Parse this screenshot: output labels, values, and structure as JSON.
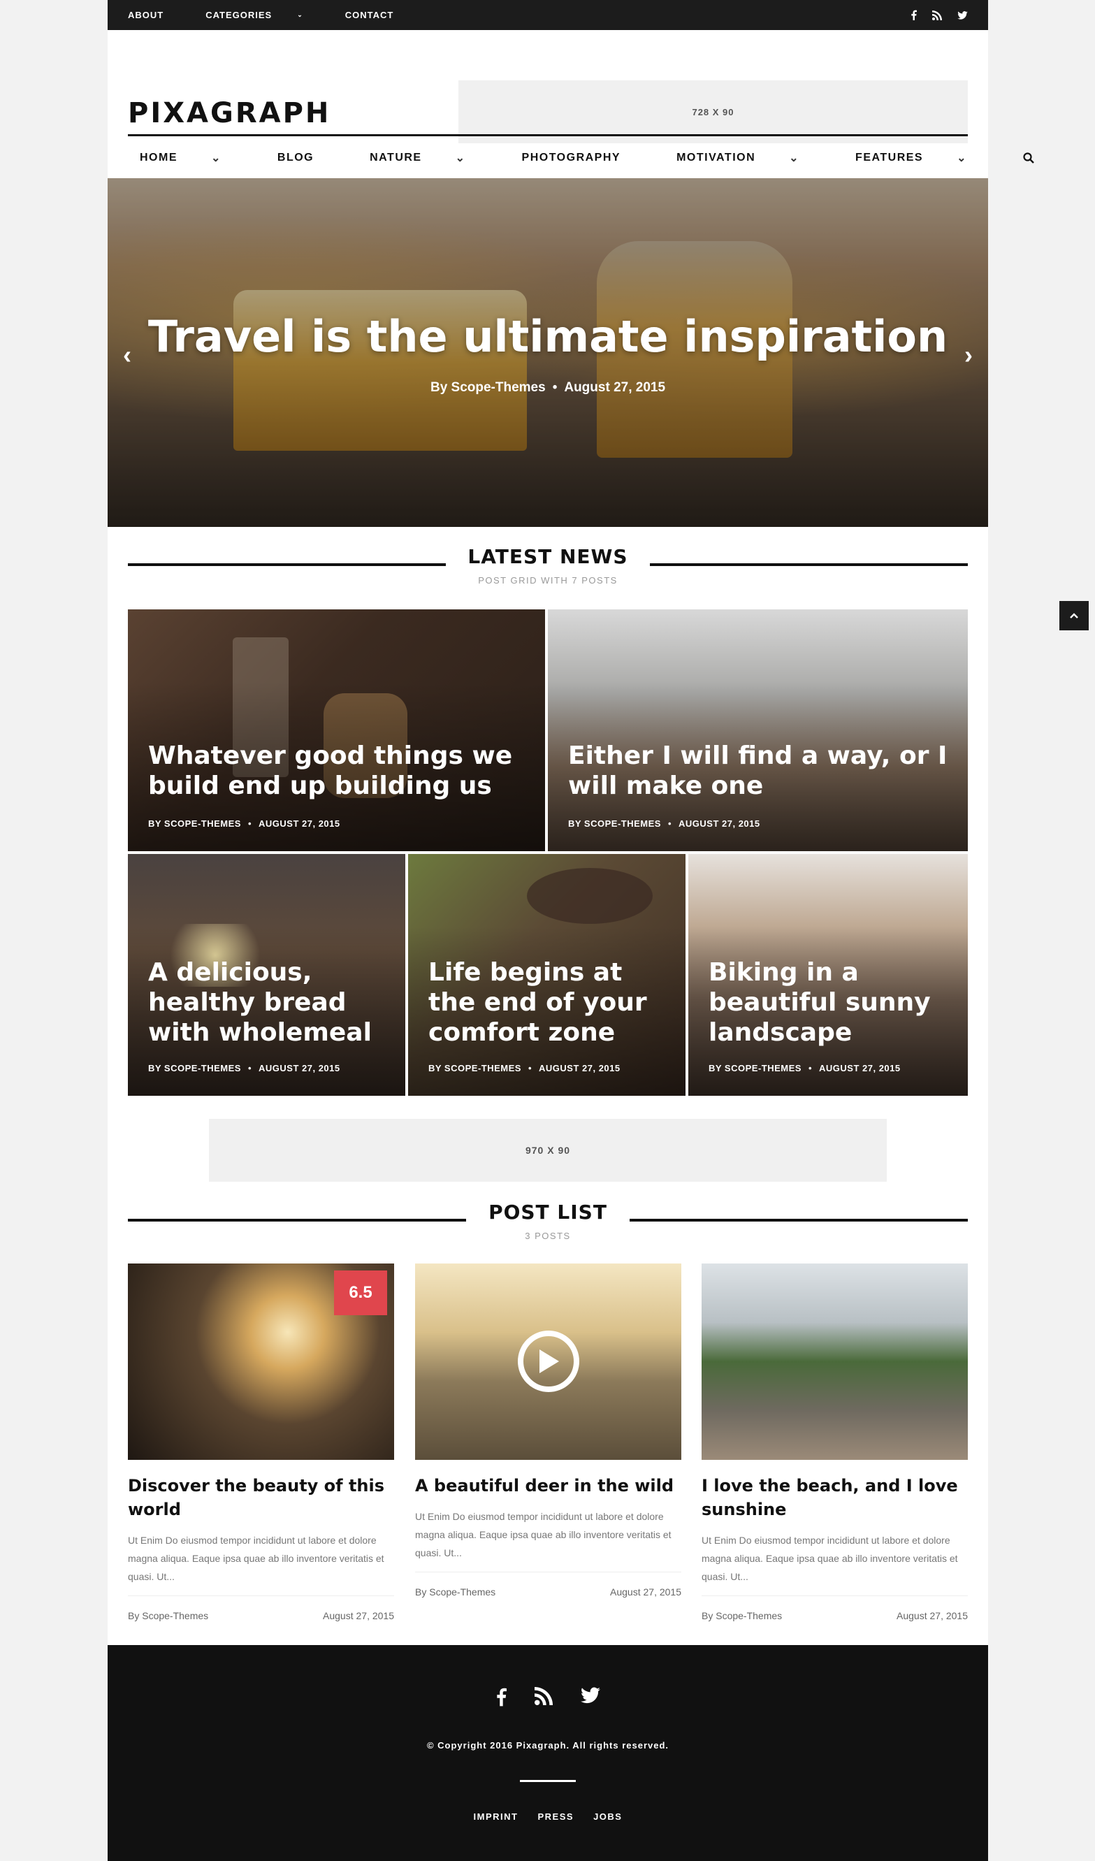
{
  "topbar": {
    "links": [
      "ABOUT",
      "CATEGORIES",
      "CONTACT"
    ],
    "icons": [
      "facebook-icon",
      "rss-icon",
      "twitter-icon"
    ]
  },
  "header": {
    "logo": "PIXAGRAPH",
    "ad_label": "728 X 90"
  },
  "nav": {
    "items": [
      {
        "label": "HOME",
        "has_dropdown": true
      },
      {
        "label": "BLOG",
        "has_dropdown": false
      },
      {
        "label": "NATURE",
        "has_dropdown": true
      },
      {
        "label": "PHOTOGRAPHY",
        "has_dropdown": false
      },
      {
        "label": "MOTIVATION",
        "has_dropdown": true
      },
      {
        "label": "FEATURES",
        "has_dropdown": true
      }
    ]
  },
  "hero": {
    "title": "Travel is the ultimate inspiration",
    "author": "By Scope-Themes",
    "date": "August 27, 2015"
  },
  "latest": {
    "title": "LATEST NEWS",
    "subtitle": "POST GRID WITH 7 POSTS",
    "cards": [
      {
        "title": "Whatever good things we build end up building us",
        "author": "BY SCOPE-THEMES",
        "date": "AUGUST 27, 2015"
      },
      {
        "title": "Either I will find a way, or I will make one",
        "author": "BY SCOPE-THEMES",
        "date": "AUGUST 27, 2015"
      },
      {
        "title": "A delicious, healthy bread with wholemeal",
        "author": "BY SCOPE-THEMES",
        "date": "AUGUST 27, 2015"
      },
      {
        "title": "Life begins at the end of your comfort zone",
        "author": "BY SCOPE-THEMES",
        "date": "AUGUST 27, 2015"
      },
      {
        "title": "Biking in a beautiful sunny landscape",
        "author": "BY SCOPE-THEMES",
        "date": "AUGUST 27, 2015"
      }
    ]
  },
  "ad_mid": "970 X 90",
  "postlist": {
    "title": "POST LIST",
    "subtitle": "3 POSTS",
    "posts": [
      {
        "title": "Discover the beauty of this world",
        "excerpt": "Ut Enim Do eiusmod tempor incididunt ut labore et dolore magna aliqua. Eaque ipsa quae ab illo inventore veritatis et quasi. Ut...",
        "author": "By Scope-Themes",
        "date": "August 27, 2015",
        "score": "6.5"
      },
      {
        "title": "A beautiful deer in the wild",
        "excerpt": "Ut Enim Do eiusmod tempor incididunt ut labore et dolore magna aliqua. Eaque ipsa quae ab illo inventore veritatis et quasi. Ut...",
        "author": "By Scope-Themes",
        "date": "August 27, 2015"
      },
      {
        "title": "I love the beach, and I love sunshine",
        "excerpt": "Ut Enim Do eiusmod tempor incididunt ut labore et dolore magna aliqua. Eaque ipsa quae ab illo inventore veritatis et quasi. Ut...",
        "author": "By Scope-Themes",
        "date": "August 27, 2015"
      }
    ]
  },
  "footer": {
    "copyright": "© Copyright 2016 Pixagraph. All rights reserved.",
    "links": [
      "IMPRINT",
      "PRESS",
      "JOBS"
    ]
  },
  "colors": {
    "dark": "#1c1c1c",
    "score_badge": "#e0464d"
  }
}
